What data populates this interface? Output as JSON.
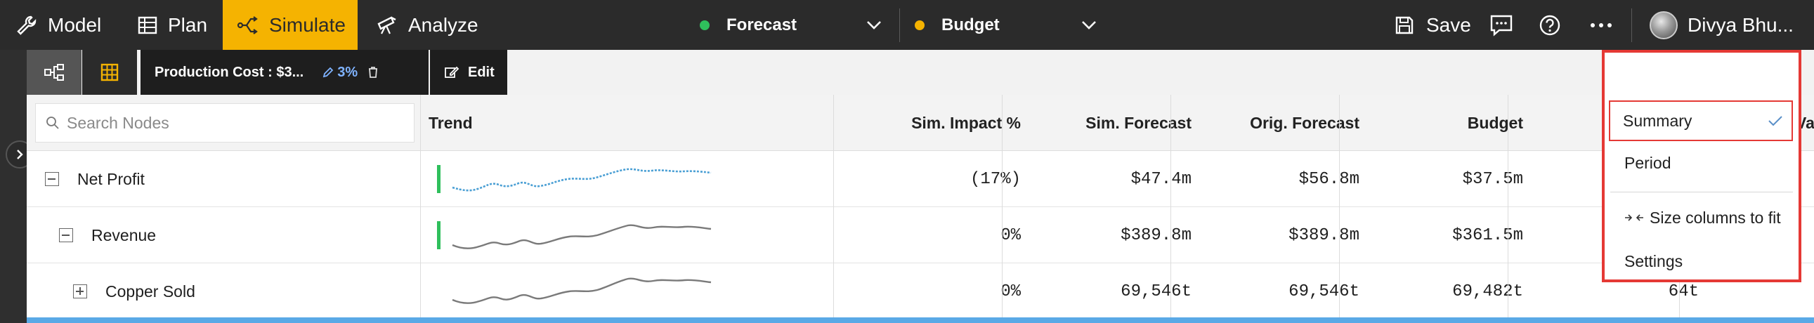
{
  "nav": {
    "items": [
      {
        "label": "Model",
        "icon": "wrench-icon"
      },
      {
        "label": "Plan",
        "icon": "table-icon"
      },
      {
        "label": "Simulate",
        "icon": "branch-icon",
        "active": true
      },
      {
        "label": "Analyze",
        "icon": "telescope-icon"
      }
    ]
  },
  "scenarios": {
    "forecast": {
      "label": "Forecast",
      "color": "#2fbf5c"
    },
    "budget": {
      "label": "Budget",
      "color": "#f5b301"
    }
  },
  "header_right": {
    "save_label": "Save",
    "user_name": "Divya Bhu..."
  },
  "toolbar": {
    "chip_label": "Production Cost : $3...",
    "chip_pct": "3%",
    "edit_label": "Edit"
  },
  "grid": {
    "search_placeholder": "Search Nodes",
    "columns": [
      "Trend",
      "Sim. Impact %",
      "Sim. Forecast",
      "Orig. Forecast",
      "Budget"
    ],
    "rows": [
      {
        "name": "Net Profit",
        "sim_impact": "(17%)",
        "sim_forecast": "$47.4m",
        "orig_forecast": "$56.8m",
        "budget": "$37.5m",
        "extra": ""
      },
      {
        "name": "Revenue",
        "sim_impact": "0%",
        "sim_forecast": "$389.8m",
        "orig_forecast": "$389.8m",
        "budget": "$361.5m",
        "extra": ""
      },
      {
        "name": "Copper Sold",
        "sim_impact": "0%",
        "sim_forecast": "69,546t",
        "orig_forecast": "69,546t",
        "budget": "69,482t",
        "extra": "64t"
      }
    ],
    "partial_header": "Va"
  },
  "menu": {
    "items": [
      "Summary",
      "Period",
      "Size columns to fit",
      "Settings"
    ]
  },
  "colors": {
    "accent": "#f5b301",
    "highlight": "#e53935",
    "trend_blue": "#4a9fd4",
    "trend_gray": "#7a7a7a"
  }
}
